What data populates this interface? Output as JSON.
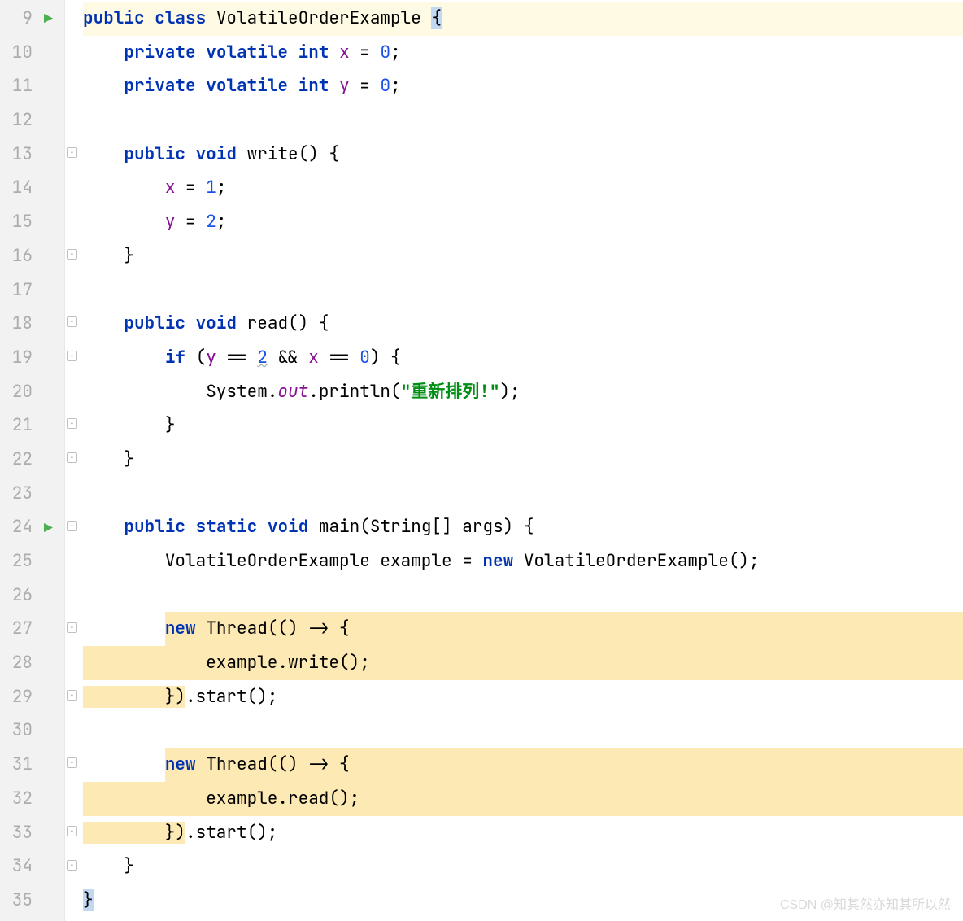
{
  "gutter": {
    "start": 9,
    "end": 35,
    "run_lines": [
      9,
      24
    ]
  },
  "code": {
    "l9": {
      "indent": "",
      "tokens": [
        {
          "c": "kw",
          "t": "public"
        },
        {
          "t": " "
        },
        {
          "c": "kw",
          "t": "class"
        },
        {
          "t": " "
        },
        {
          "c": "type",
          "t": "VolatileOrderExample"
        },
        {
          "t": " "
        },
        {
          "c": "caret-brace",
          "t": "{"
        }
      ],
      "hl": "full"
    },
    "l10": {
      "indent": "    ",
      "tokens": [
        {
          "c": "kw",
          "t": "private"
        },
        {
          "t": " "
        },
        {
          "c": "kw",
          "t": "volatile"
        },
        {
          "t": " "
        },
        {
          "c": "kw",
          "t": "int"
        },
        {
          "t": " "
        },
        {
          "c": "field",
          "t": "x"
        },
        {
          "t": " = "
        },
        {
          "c": "num",
          "t": "0"
        },
        {
          "t": ";"
        }
      ]
    },
    "l11": {
      "indent": "    ",
      "tokens": [
        {
          "c": "kw",
          "t": "private"
        },
        {
          "t": " "
        },
        {
          "c": "kw",
          "t": "volatile"
        },
        {
          "t": " "
        },
        {
          "c": "kw",
          "t": "int"
        },
        {
          "t": " "
        },
        {
          "c": "field",
          "t": "y"
        },
        {
          "t": " = "
        },
        {
          "c": "num",
          "t": "0"
        },
        {
          "t": ";"
        }
      ]
    },
    "l12": {
      "indent": "",
      "tokens": []
    },
    "l13": {
      "indent": "    ",
      "tokens": [
        {
          "c": "kw",
          "t": "public"
        },
        {
          "t": " "
        },
        {
          "c": "kw",
          "t": "void"
        },
        {
          "t": " "
        },
        {
          "c": "method",
          "t": "write"
        },
        {
          "t": "() {"
        }
      ]
    },
    "l14": {
      "indent": "        ",
      "tokens": [
        {
          "c": "field",
          "t": "x"
        },
        {
          "t": " = "
        },
        {
          "c": "num",
          "t": "1"
        },
        {
          "t": ";"
        }
      ]
    },
    "l15": {
      "indent": "        ",
      "tokens": [
        {
          "c": "field",
          "t": "y"
        },
        {
          "t": " = "
        },
        {
          "c": "num",
          "t": "2"
        },
        {
          "t": ";"
        }
      ]
    },
    "l16": {
      "indent": "    ",
      "tokens": [
        {
          "t": "}"
        }
      ]
    },
    "l17": {
      "indent": "",
      "tokens": []
    },
    "l18": {
      "indent": "    ",
      "tokens": [
        {
          "c": "kw",
          "t": "public"
        },
        {
          "t": " "
        },
        {
          "c": "kw",
          "t": "void"
        },
        {
          "t": " "
        },
        {
          "c": "method",
          "t": "read"
        },
        {
          "t": "() {"
        }
      ]
    },
    "l19": {
      "indent": "        ",
      "tokens": [
        {
          "c": "kw",
          "t": "if"
        },
        {
          "t": " ("
        },
        {
          "c": "field",
          "t": "y"
        },
        {
          "t": " == "
        },
        {
          "c": "num underline",
          "t": "2"
        },
        {
          "t": " && "
        },
        {
          "c": "field",
          "t": "x"
        },
        {
          "t": " == "
        },
        {
          "c": "num",
          "t": "0"
        },
        {
          "t": ") {"
        }
      ]
    },
    "l20": {
      "indent": "            ",
      "tokens": [
        {
          "t": "System."
        },
        {
          "c": "staticf",
          "t": "out"
        },
        {
          "t": ".println("
        },
        {
          "c": "str",
          "t": "\"重新排列!\""
        },
        {
          "t": ");"
        }
      ]
    },
    "l21": {
      "indent": "        ",
      "tokens": [
        {
          "t": "}"
        }
      ]
    },
    "l22": {
      "indent": "    ",
      "tokens": [
        {
          "t": "}"
        }
      ]
    },
    "l23": {
      "indent": "",
      "tokens": []
    },
    "l24": {
      "indent": "    ",
      "tokens": [
        {
          "c": "kw",
          "t": "public"
        },
        {
          "t": " "
        },
        {
          "c": "kw",
          "t": "static"
        },
        {
          "t": " "
        },
        {
          "c": "kw",
          "t": "void"
        },
        {
          "t": " "
        },
        {
          "c": "method",
          "t": "main"
        },
        {
          "t": "(String[] args) {"
        }
      ]
    },
    "l25": {
      "indent": "        ",
      "tokens": [
        {
          "t": "VolatileOrderExample example = "
        },
        {
          "c": "kw",
          "t": "new"
        },
        {
          "t": " VolatileOrderExample();"
        }
      ]
    },
    "l26": {
      "indent": "",
      "tokens": []
    },
    "l27": {
      "indent": "        ",
      "tokens": [
        {
          "c": "kw",
          "t": "new"
        },
        {
          "t": " Thread(() -> {"
        }
      ],
      "hl": "from8"
    },
    "l28": {
      "indent": "            ",
      "tokens": [
        {
          "t": "example.write();"
        }
      ],
      "hl": "full"
    },
    "l29": {
      "indent": "        ",
      "tokens": [
        {
          "t": "})"
        },
        {
          "t": ".start();"
        }
      ],
      "hl": "to10"
    },
    "l30": {
      "indent": "",
      "tokens": []
    },
    "l31": {
      "indent": "        ",
      "tokens": [
        {
          "c": "kw",
          "t": "new"
        },
        {
          "t": " Thread(() -> {"
        }
      ],
      "hl": "from8"
    },
    "l32": {
      "indent": "            ",
      "tokens": [
        {
          "t": "example.read();"
        }
      ],
      "hl": "full"
    },
    "l33": {
      "indent": "        ",
      "tokens": [
        {
          "t": "})"
        },
        {
          "t": ".start();"
        }
      ],
      "hl": "to10"
    },
    "l34": {
      "indent": "    ",
      "tokens": [
        {
          "t": "}"
        }
      ]
    },
    "l35": {
      "indent": "",
      "tokens": [
        {
          "c": "caret-brace",
          "t": "}"
        }
      ]
    }
  },
  "watermark": "CSDN @知其然亦知其所以然"
}
